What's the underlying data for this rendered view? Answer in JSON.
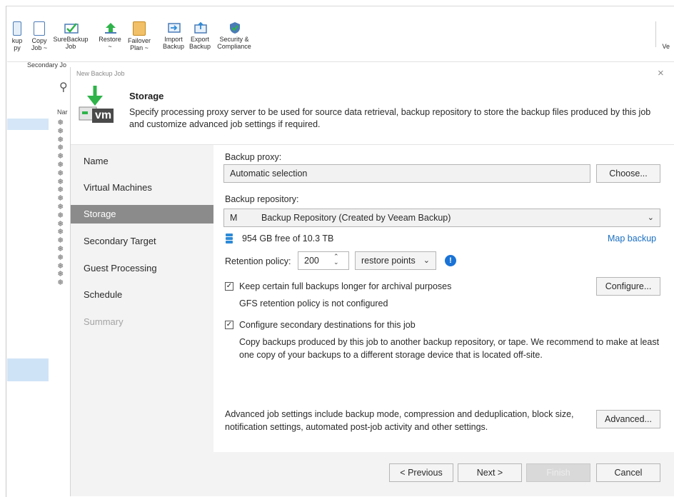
{
  "ribbon": {
    "items": [
      {
        "label": "kup\npy",
        "icon": "backup-copy-icon"
      },
      {
        "label": "Copy\nJob ~",
        "icon": "copy-job-icon"
      },
      {
        "label": "SureBackup\nJob",
        "icon": "surebackup-icon"
      },
      {
        "label": "Restore\n~",
        "icon": "restore-icon"
      },
      {
        "label": "Failover\nPlan ~",
        "icon": "failover-plan-icon"
      },
      {
        "label": "Import\nBackup",
        "icon": "import-backup-icon"
      },
      {
        "label": "Export\nBackup",
        "icon": "export-backup-icon"
      },
      {
        "label": "Security &\nCompliance",
        "icon": "security-compliance-icon"
      }
    ],
    "group_label": "Secondary Jo",
    "right_label": "Ve"
  },
  "background": {
    "column_header": "Nar"
  },
  "dialog": {
    "title": "New Backup Job",
    "close": "×",
    "header": {
      "title": "Storage",
      "description": "Specify processing proxy server to be used for source data retrieval, backup repository to store the backup files produced by this job and customize advanced job settings if required.",
      "icon_text": "vm"
    },
    "steps": [
      {
        "label": "Name",
        "state": "normal"
      },
      {
        "label": "Virtual Machines",
        "state": "normal"
      },
      {
        "label": "Storage",
        "state": "active"
      },
      {
        "label": "Secondary Target",
        "state": "normal"
      },
      {
        "label": "Guest Processing",
        "state": "normal"
      },
      {
        "label": "Schedule",
        "state": "normal"
      },
      {
        "label": "Summary",
        "state": "disabled"
      }
    ],
    "proxy": {
      "label": "Backup proxy:",
      "value": "Automatic selection",
      "choose_button": "Choose..."
    },
    "repository": {
      "label": "Backup repository:",
      "prefix": "M",
      "value": "Backup Repository (Created by Veeam Backup)",
      "free_space": "954 GB free of 10.3 TB",
      "map_link": "Map backup"
    },
    "retention": {
      "label": "Retention policy:",
      "value": "200",
      "unit": "restore points",
      "info": "!"
    },
    "gfs": {
      "checked": true,
      "label": "Keep certain full backups longer for archival purposes",
      "status": "GFS retention policy is not configured",
      "configure_button": "Configure..."
    },
    "secondary": {
      "checked": true,
      "label": "Configure secondary destinations for this job",
      "description": "Copy backups produced by this job to another backup repository, or tape. We recommend to make at least one copy of your backups to a different storage device that is located off-site."
    },
    "advanced": {
      "description": "Advanced job settings include backup mode, compression and deduplication, block size, notification settings, automated post-job activity and other settings.",
      "button": "Advanced..."
    },
    "footer": {
      "previous": "< Previous",
      "next": "Next >",
      "finish": "Finish",
      "cancel": "Cancel"
    }
  },
  "colors": {
    "accent_link": "#1a6fc2",
    "active_step": "#8b8b8b",
    "info_icon": "#1a73d6",
    "veeam_green": "#2fb34a"
  }
}
